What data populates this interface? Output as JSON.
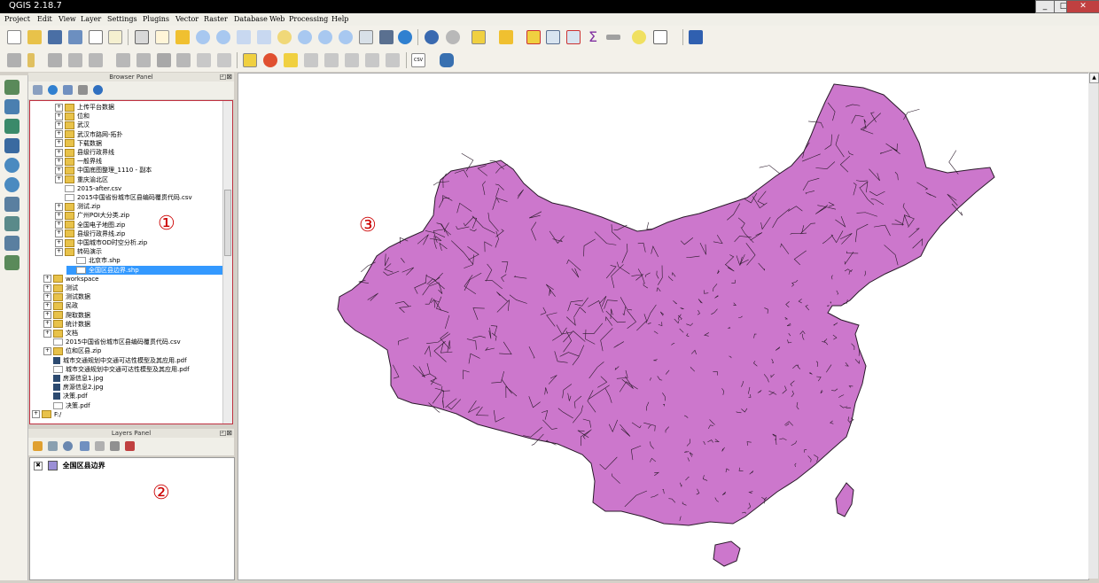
{
  "window": {
    "title": "QGIS 2.18.7"
  },
  "menu": [
    "Project",
    "Edit",
    "View",
    "Layer",
    "Settings",
    "Plugins",
    "Vector",
    "Raster",
    "Database",
    "Web",
    "Processing",
    "Help"
  ],
  "browser_panel": {
    "title": "Browser Panel",
    "items": [
      {
        "label": "上传平台数据",
        "indent": 2,
        "kind": "folder"
      },
      {
        "label": "位和",
        "indent": 2,
        "kind": "folder"
      },
      {
        "label": "武汉",
        "indent": 2,
        "kind": "folder"
      },
      {
        "label": "武汉市路网-拓扑",
        "indent": 2,
        "kind": "folder"
      },
      {
        "label": "下载数据",
        "indent": 2,
        "kind": "folder"
      },
      {
        "label": "县级行政界线",
        "indent": 2,
        "kind": "folder"
      },
      {
        "label": "一般界线",
        "indent": 2,
        "kind": "folder"
      },
      {
        "label": "中国底图整理_1110 - 副本",
        "indent": 2,
        "kind": "folder"
      },
      {
        "label": "重庆渝北区",
        "indent": 2,
        "kind": "folder"
      },
      {
        "label": "2015-after.csv",
        "indent": 2,
        "kind": "file"
      },
      {
        "label": "2015中国省份城市区县编码覆贯代码.csv",
        "indent": 2,
        "kind": "file"
      },
      {
        "label": "测试.zip",
        "indent": 2,
        "kind": "folder"
      },
      {
        "label": "广州POI大分类.zip",
        "indent": 2,
        "kind": "folder"
      },
      {
        "label": "全国电子地图.zip",
        "indent": 2,
        "kind": "folder"
      },
      {
        "label": "县级行政界线.zip",
        "indent": 2,
        "kind": "folder"
      },
      {
        "label": "中国城市OD时空分析.zip",
        "indent": 2,
        "kind": "folder"
      },
      {
        "label": "转码演示",
        "indent": 2,
        "kind": "folder"
      },
      {
        "label": "北京市.shp",
        "indent": 3,
        "kind": "file"
      },
      {
        "label": "全国区县边界.shp",
        "indent": 3,
        "kind": "file",
        "selected": true
      },
      {
        "label": "workspace",
        "indent": 1,
        "kind": "folder"
      },
      {
        "label": "测试",
        "indent": 1,
        "kind": "folder"
      },
      {
        "label": "测试数据",
        "indent": 1,
        "kind": "folder"
      },
      {
        "label": "民政",
        "indent": 1,
        "kind": "folder"
      },
      {
        "label": "爬取数据",
        "indent": 1,
        "kind": "folder"
      },
      {
        "label": "统计数据",
        "indent": 1,
        "kind": "folder"
      },
      {
        "label": "文档",
        "indent": 1,
        "kind": "folder"
      },
      {
        "label": "2015中国省份城市区县编码覆贯代码.csv",
        "indent": 1,
        "kind": "file"
      },
      {
        "label": "位和区县.zip",
        "indent": 1,
        "kind": "folder"
      },
      {
        "label": "城市交通规划中交通可达性模型及其应用.pdf",
        "indent": 1,
        "kind": "image"
      },
      {
        "label": "城市交通规划中交通可达性模型及其应用.pdf",
        "indent": 1,
        "kind": "file"
      },
      {
        "label": "房源信息1.jpg",
        "indent": 1,
        "kind": "image"
      },
      {
        "label": "房源信息2.jpg",
        "indent": 1,
        "kind": "image"
      },
      {
        "label": "决策.pdf",
        "indent": 1,
        "kind": "image"
      },
      {
        "label": "决策.pdf",
        "indent": 1,
        "kind": "file"
      },
      {
        "label": "F:/",
        "indent": 0,
        "kind": "folder"
      }
    ]
  },
  "layers_panel": {
    "title": "Layers Panel",
    "layers": [
      {
        "name": "全国区县边界",
        "visible": true,
        "color": "#9b8fd6"
      }
    ]
  },
  "annotations": {
    "one": "①",
    "two": "②",
    "three": "③"
  },
  "colors": {
    "map_fill": "#cc77cc",
    "map_stroke": "#2a1a2a",
    "accent": "#3399ff",
    "annotation": "#cc0000"
  }
}
